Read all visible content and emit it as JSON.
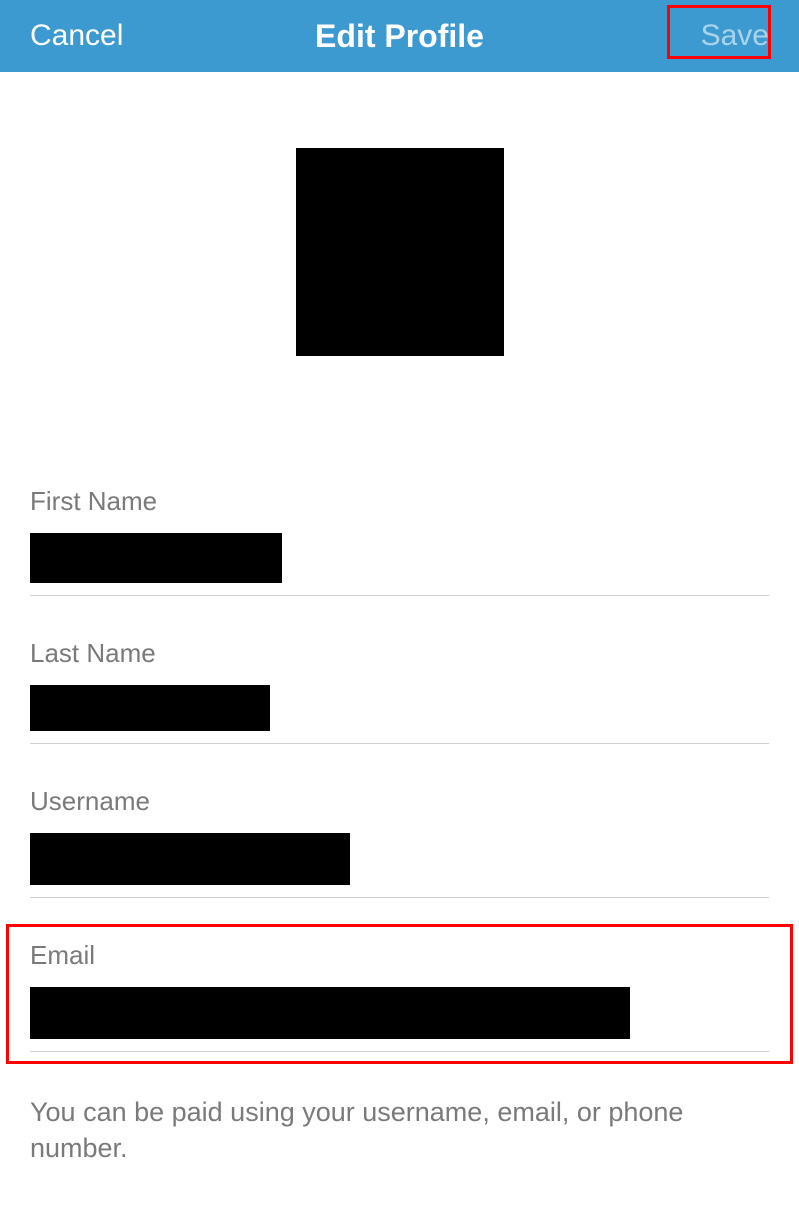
{
  "header": {
    "cancel_label": "Cancel",
    "title": "Edit Profile",
    "save_label": "Save"
  },
  "fields": {
    "first_name": {
      "label": "First Name"
    },
    "last_name": {
      "label": "Last Name"
    },
    "username": {
      "label": "Username"
    },
    "email": {
      "label": "Email"
    }
  },
  "help_text": "You can be paid using your username, email, or phone number."
}
